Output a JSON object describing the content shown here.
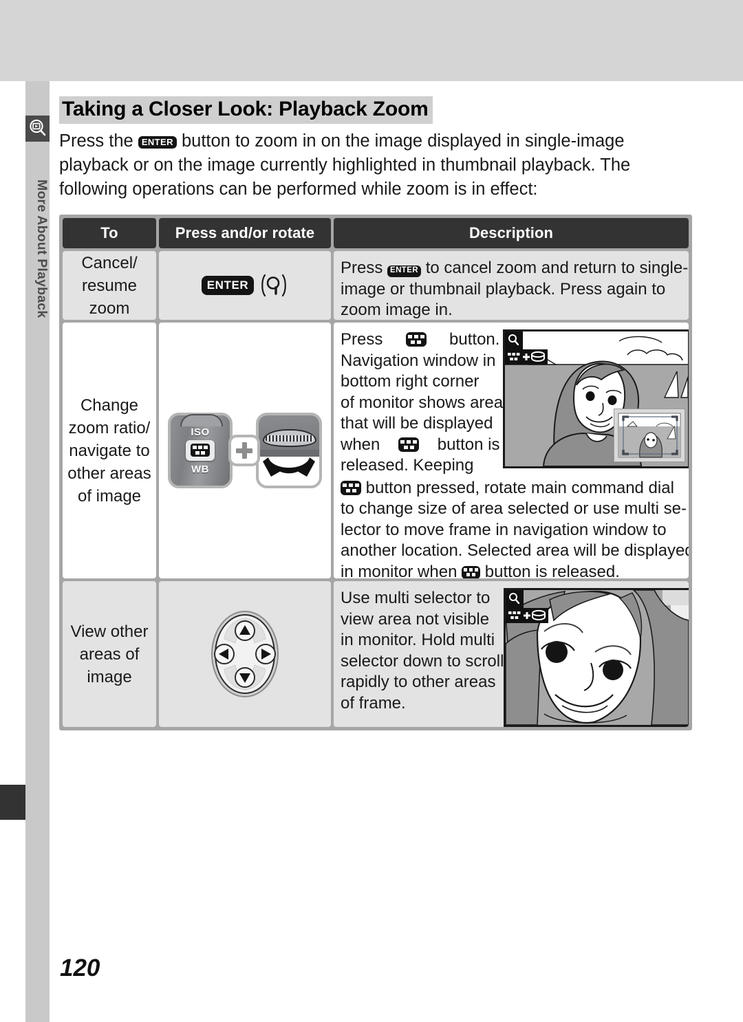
{
  "page": {
    "number": "120",
    "sidebar_label": "More About Playback",
    "sidebar_icon": "playback-zoom-icon"
  },
  "heading": "Taking a Closer Look: Playback Zoom",
  "intro": {
    "line1_a": "Press  the",
    "line1_icon": "ENTER",
    "line1_b": "button  to  zoom  in  on  the  image  displayed  in  single-image",
    "line2": "playback or on the image currently highlighted in thumbnail playback.  The",
    "line3": "following operations can be performed while zoom is in effect:"
  },
  "table": {
    "headers": {
      "to": "To",
      "press": "Press and/or rotate",
      "description": "Description"
    },
    "rows": [
      {
        "to": "Cancel/\nresume\nzoom",
        "to_lines": [
          "Cancel/",
          "resume",
          "zoom"
        ],
        "control_icons": [
          "enter-button-icon",
          "magnifier-icon"
        ],
        "control_label": "ENTER",
        "desc_lines": [
          "Press  Ⓐ  to cancel zoom and return to single-",
          "image  or  thumbnail  playback.    Press  again  to",
          "zoom image in."
        ],
        "desc_seg": {
          "a": "Press",
          "b": "to  cancel  zoom  and  return  to  single-",
          "c": "image  or  thumbnail  playback.    Press  again  to",
          "d": "zoom image in."
        }
      },
      {
        "to_lines": [
          "Change",
          "zoom ratio/",
          "navigate to",
          "other areas",
          "of image"
        ],
        "control_icons": [
          "iso-wb-button-photo",
          "plus-icon",
          "main-command-dial-photo"
        ],
        "control_labels": {
          "iso": "ISO",
          "wb": "WB"
        },
        "desc_seg": {
          "l1a": "Press",
          "l1b": "button.",
          "l2": "Navigation  window  in",
          "l3": "bottom   right   corner",
          "l4": "of monitor shows area",
          "l5": "that  will  be  displayed",
          "l6a": "when",
          "l6b": "button   is",
          "l7": "released.        Keeping",
          "l8": "button  pressed,  rotate  main  command  dial",
          "l9": "to change size of area selected or use multi se-",
          "l10": "lector  to  move  frame  in  navigation  window  to",
          "l11": "another location. Selected area will be displayed",
          "l12a": "in monitor when",
          "l12b": "button is released."
        },
        "figure": {
          "name": "monitor-navigation-window-illustration",
          "badge": "zoom-thumbnail-dial-badge"
        }
      },
      {
        "to_lines": [
          "View other",
          "areas of",
          "image"
        ],
        "control_icons": [
          "multi-selector-icon"
        ],
        "desc_seg": {
          "l1": "Use   multi   selector   to",
          "l2": "view   area   not   visible",
          "l3": "in  monitor.   Hold  multi",
          "l4": "selector down to scroll",
          "l5": "rapidly   to   other   areas",
          "l6": "of frame."
        },
        "figure": {
          "name": "monitor-zoomed-face-illustration",
          "badge": "zoom-thumbnail-dial-badge"
        }
      }
    ]
  },
  "colors": {
    "header_bg": "#333333",
    "table_border": "#a6a6a6",
    "row_gray": "#e3e3e3",
    "row_white": "#ffffff",
    "band": "#d5d5d5",
    "sidebar": "#c9c9c9",
    "heading_highlight": "#cfcfcf"
  }
}
